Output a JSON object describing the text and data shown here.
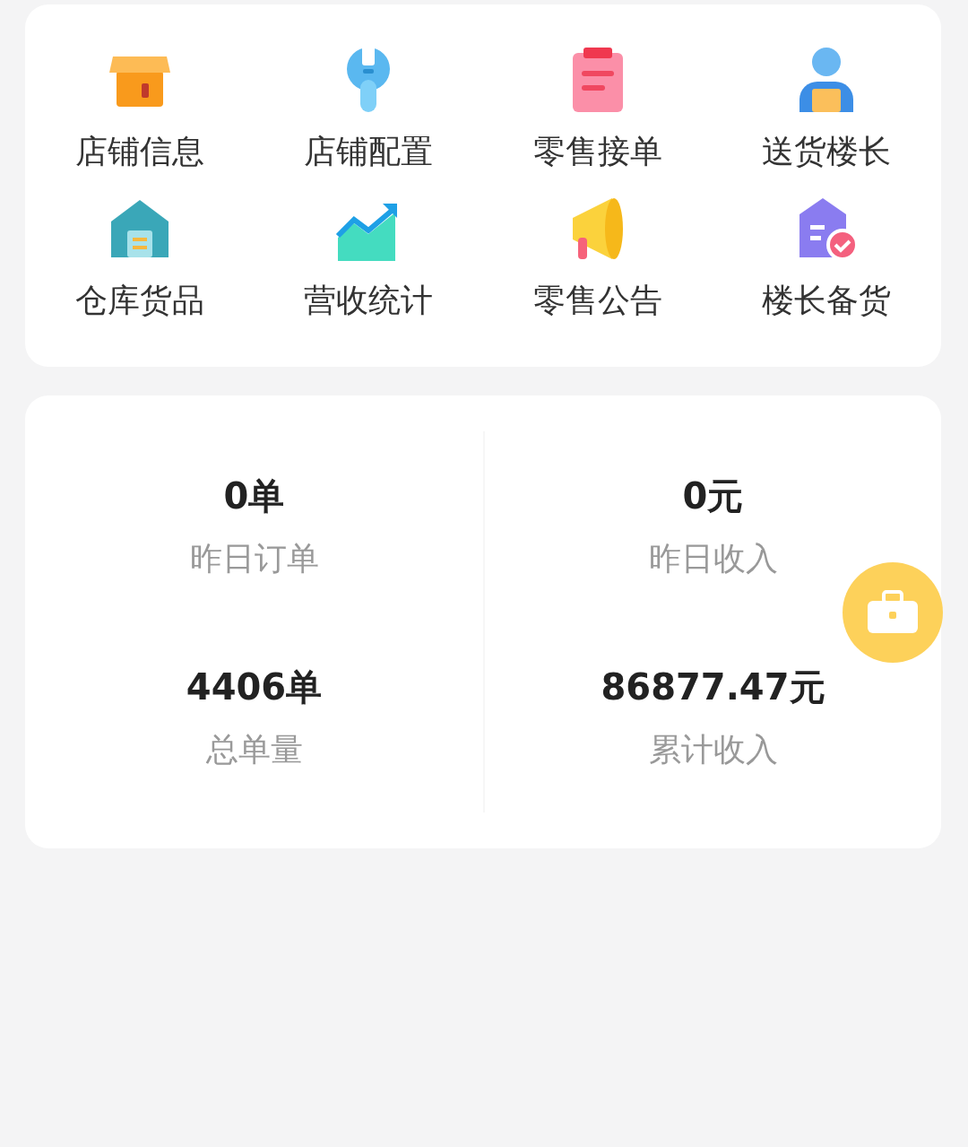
{
  "menu": {
    "items": [
      {
        "kind": "store",
        "label": "店铺信息"
      },
      {
        "kind": "wrench",
        "label": "店铺配置"
      },
      {
        "kind": "clipboard",
        "label": "零售接单"
      },
      {
        "kind": "courier",
        "label": "送货楼长"
      },
      {
        "kind": "warehouse",
        "label": "仓库货品"
      },
      {
        "kind": "chart",
        "label": "营收统计"
      },
      {
        "kind": "megaphone",
        "label": "零售公告"
      },
      {
        "kind": "document",
        "label": "楼长备货"
      }
    ]
  },
  "stats": [
    {
      "value": "0单",
      "label": "昨日订单"
    },
    {
      "value": "0元",
      "label": "昨日收入"
    },
    {
      "value": "4406单",
      "label": "总单量"
    },
    {
      "value": "86877.47元",
      "label": "累计收入"
    }
  ]
}
